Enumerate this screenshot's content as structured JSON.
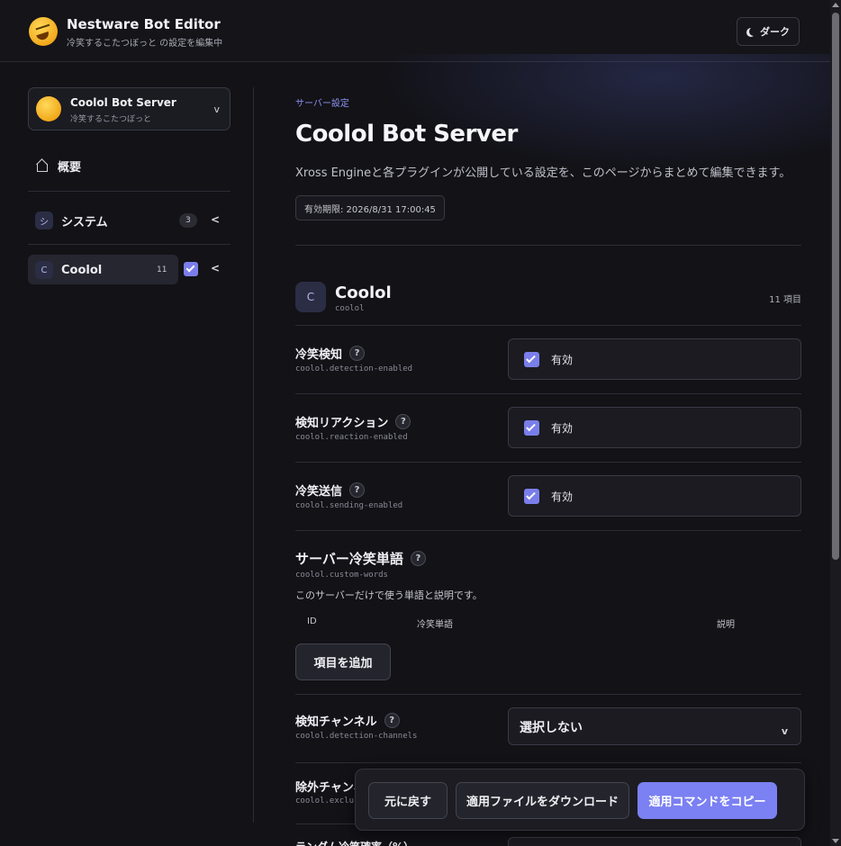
{
  "header": {
    "title": "Nestware Bot Editor",
    "subtitle": "冷笑するこたつぼっと の設定を編集中",
    "theme_label": "ダーク",
    "logo_icon": "laughing-emoji-icon"
  },
  "sidebar": {
    "server": {
      "name": "Coolol Bot Server",
      "sub": "冷笑するこたつぼっと",
      "chevron": "v"
    },
    "overview_label": "概要",
    "items": [
      {
        "badge": "シ",
        "label": "システム",
        "count": "3",
        "arrow": "<"
      },
      {
        "badge": "C",
        "label": "Coolol",
        "count": "11",
        "arrow": "<",
        "checked": true
      }
    ]
  },
  "main": {
    "eyebrow": "サーバー設定",
    "title": "Coolol Bot Server",
    "description": "Xross Engineと各プラグインが公開している設定を、このページからまとめて編集できます。",
    "expiry": "有効期限: 2026/8/31 17:00:45",
    "plugin": {
      "badge": "C",
      "name": "Coolol",
      "id": "coolol",
      "count": "11 項目"
    },
    "settings": [
      {
        "label": "冷笑検知",
        "key": "coolol.detection-enabled",
        "value_label": "有効",
        "checked": true
      },
      {
        "label": "検知リアクション",
        "key": "coolol.reaction-enabled",
        "value_label": "有効",
        "checked": true
      },
      {
        "label": "冷笑送信",
        "key": "coolol.sending-enabled",
        "value_label": "有効",
        "checked": true
      }
    ],
    "custom_words": {
      "label": "サーバー冷笑単語",
      "key": "coolol.custom-words",
      "description": "このサーバーだけで使う単語と説明です。",
      "columns": [
        "ID",
        "冷笑単語",
        "説明"
      ],
      "add_label": "項目を追加"
    },
    "detection_channels": {
      "label": "検知チャンネル",
      "key": "coolol.detection-channels",
      "value": "選択しない",
      "chevron": "v"
    },
    "exclude_channels": {
      "label": "除外チャンネ",
      "key": "coolol.exclu"
    },
    "partial_label": "ランダム冷笑確率（%）"
  },
  "actions": {
    "revert": "元に戻す",
    "download": "適用ファイルをダウンロード",
    "copy": "適用コマンドをコピー"
  },
  "colors": {
    "accent": "#7b80f2",
    "background": "#121217",
    "panel": "#1b1b21"
  },
  "help_glyph": "?"
}
